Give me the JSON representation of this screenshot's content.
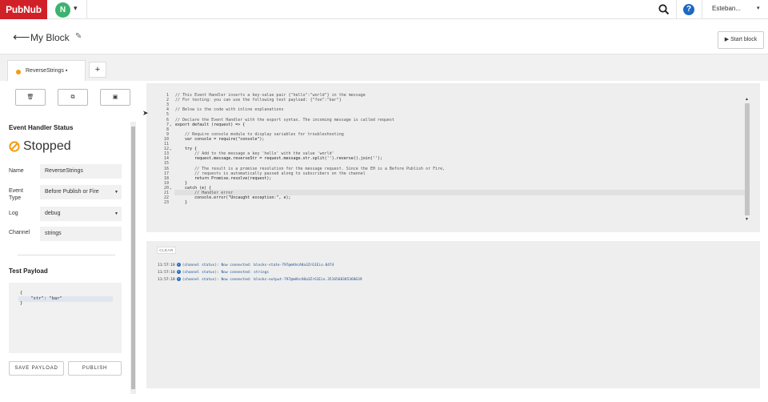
{
  "topbar": {
    "logo": "PubNub",
    "account_initial": "N",
    "user_name": "Esteban..."
  },
  "header": {
    "title": "My Block",
    "start_button": "Start block"
  },
  "tabs": [
    {
      "label": "ReverseStrings"
    }
  ],
  "left": {
    "status_title": "Event Handler Status",
    "status": "Stopped",
    "fields": {
      "name_label": "Name",
      "name_value": "ReverseStrings",
      "event_type_label_1": "Event",
      "event_type_label_2": "Type",
      "event_type_value": "Before Publish or Fire",
      "log_label": "Log",
      "log_value": "debug",
      "channel_label": "Channel",
      "channel_value": "strings"
    },
    "payload_title": "Test Payload",
    "payload_text": "{\n    \"str\": \"bar\"\n}",
    "save_payload": "SAVE PAYLOAD",
    "publish": "PUBLISH"
  },
  "editor": {
    "lines": [
      {
        "n": "1",
        "fold": "",
        "t": "// This Event Handler inserts a key-value pair {\"hello\":\"world\"} in the message",
        "c": true
      },
      {
        "n": "2",
        "fold": "",
        "t": "// For testing: you can use the following test payload: {\"foo\":\"bar\"}",
        "c": true
      },
      {
        "n": "3",
        "fold": "",
        "t": "",
        "c": false
      },
      {
        "n": "4",
        "fold": "",
        "t": "// Below is the code with inline explanations",
        "c": true
      },
      {
        "n": "5",
        "fold": "",
        "t": "",
        "c": false
      },
      {
        "n": "6",
        "fold": "",
        "t": "// Declare the Event Handler with the export syntax. The incoming message is called request",
        "c": true
      },
      {
        "n": "7",
        "fold": "▾",
        "t": "export default (request) => {",
        "c": false
      },
      {
        "n": "8",
        "fold": "",
        "t": "",
        "c": false
      },
      {
        "n": "9",
        "fold": "",
        "t": "    // Require console module to display variables for troubleshooting",
        "c": true
      },
      {
        "n": "10",
        "fold": "",
        "t": "    var console = require(\"console\");",
        "c": false
      },
      {
        "n": "11",
        "fold": "",
        "t": "",
        "c": false
      },
      {
        "n": "12",
        "fold": "▾",
        "t": "    try {",
        "c": false
      },
      {
        "n": "13",
        "fold": "",
        "t": "        // Add to the message a key 'hello' with the value 'world'",
        "c": true
      },
      {
        "n": "14",
        "fold": "",
        "t": "        request.message.reverseStr = request.message.str.split('').reverse().join('');",
        "c": false
      },
      {
        "n": "15",
        "fold": "",
        "t": "",
        "c": false
      },
      {
        "n": "16",
        "fold": "",
        "t": "        // The result is a promise resolution for the message request. Since the EH is a Before Publish or Fire,",
        "c": true
      },
      {
        "n": "17",
        "fold": "",
        "t": "        // requests is automatically passed along to subscribers on the channel",
        "c": true
      },
      {
        "n": "18",
        "fold": "",
        "t": "        return Promise.resolve(request);",
        "c": false
      },
      {
        "n": "19",
        "fold": "",
        "t": "    }",
        "c": false
      },
      {
        "n": "20",
        "fold": "▾",
        "t": "    catch (e) {",
        "c": false
      },
      {
        "n": "21",
        "fold": "",
        "t": "        // Handler error",
        "c": true
      },
      {
        "n": "22",
        "fold": "",
        "t": "        console.error(\"Uncaught exception:\", e);",
        "c": false
      },
      {
        "n": "23",
        "fold": "",
        "t": "    }",
        "c": false
      }
    ]
  },
  "console": {
    "clear_label": "CLEAR",
    "logs": [
      {
        "time": "11:57:18",
        "text": "(channel status): Now connected: blocks-state-797@mAhcA8a3ZrG1Eio.0474"
      },
      {
        "time": "11:57:18",
        "text": "(channel status): Now connected: strings"
      },
      {
        "time": "11:57:18",
        "text": "(channel status): Now connected: blocks-output-797@mAhcA8a3ZrG1Eio.3516568385368639"
      }
    ]
  },
  "colors": {
    "brand": "#d02129",
    "stopped": "#f39c12",
    "info": "#1d68c2"
  }
}
